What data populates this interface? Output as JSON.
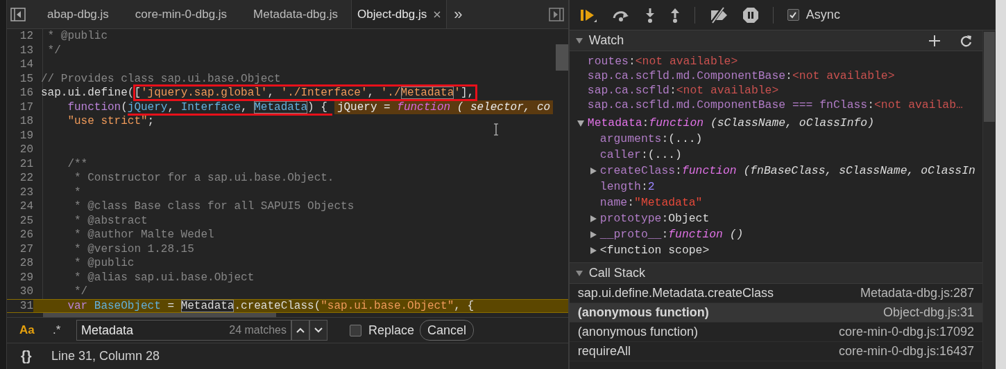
{
  "tabs": [
    {
      "label": "abap-dbg.js",
      "selected": false
    },
    {
      "label": "core-min-0-dbg.js",
      "selected": false
    },
    {
      "label": "Metadata-dbg.js",
      "selected": false
    },
    {
      "label": "Object-dbg.js",
      "selected": true
    }
  ],
  "more_tabs": "»",
  "code": {
    "lines": [
      {
        "number": "12",
        "paused": false,
        "segments": [
          {
            "text": " * @public",
            "kind": "comment"
          }
        ]
      },
      {
        "number": "13",
        "paused": false,
        "segments": [
          {
            "text": " */",
            "kind": "comment"
          }
        ]
      },
      {
        "number": "14",
        "paused": false
      },
      {
        "number": "15",
        "paused": false,
        "segments": [
          {
            "text": "// Provides class sap.ui.base.Object",
            "kind": "comment"
          }
        ]
      },
      {
        "number": "16",
        "paused": false,
        "segments": [
          {
            "text": "sap.ui.define([",
            "kind": "plain"
          },
          {
            "text": "'jquery.sap.global'",
            "kind": "string"
          },
          {
            "text": ", ",
            "kind": "plain"
          },
          {
            "text": "'./Interface'",
            "kind": "string"
          },
          {
            "text": ", ",
            "kind": "plain"
          },
          {
            "text": "'./",
            "kind": "string"
          },
          {
            "text": "Metadata",
            "kind": "string-match"
          },
          {
            "text": "'",
            "kind": "string"
          },
          {
            "text": "],",
            "kind": "plain"
          }
        ]
      },
      {
        "number": "17",
        "paused": false,
        "segments": [
          {
            "text": "    function",
            "kind": "keyword"
          },
          {
            "text": "(",
            "kind": "plain"
          },
          {
            "text": "jQuery",
            "kind": "param"
          },
          {
            "text": ", ",
            "kind": "plain"
          },
          {
            "text": "Interface",
            "kind": "param"
          },
          {
            "text": ", ",
            "kind": "plain"
          },
          {
            "text": "Metadata",
            "kind": "param-match"
          },
          {
            "text": ") {",
            "kind": "plain"
          }
        ],
        "inline_value": [
          {
            "text": "jQuery = ",
            "kind": "name"
          },
          {
            "text": "function",
            "kind": "keyword"
          },
          {
            "text": " ( selector, co",
            "kind": "args"
          }
        ]
      },
      {
        "number": "18",
        "paused": false,
        "segments": [
          {
            "text": "    \"use strict\"",
            "kind": "string"
          },
          {
            "text": ";",
            "kind": "plain"
          }
        ]
      },
      {
        "number": "19",
        "paused": false
      },
      {
        "number": "20",
        "paused": false
      },
      {
        "number": "21",
        "paused": false,
        "segments": [
          {
            "text": "    /**",
            "kind": "comment"
          }
        ]
      },
      {
        "number": "22",
        "paused": false,
        "segments": [
          {
            "text": "     * Constructor for a sap.ui.base.Object.",
            "kind": "comment"
          }
        ]
      },
      {
        "number": "23",
        "paused": false,
        "segments": [
          {
            "text": "     *",
            "kind": "comment"
          }
        ]
      },
      {
        "number": "24",
        "paused": false,
        "segments": [
          {
            "text": "     * @class Base class for all SAPUI5 Objects",
            "kind": "comment"
          }
        ]
      },
      {
        "number": "25",
        "paused": false,
        "segments": [
          {
            "text": "     * @abstract",
            "kind": "comment"
          }
        ]
      },
      {
        "number": "26",
        "paused": false,
        "segments": [
          {
            "text": "     * @author Malte Wedel",
            "kind": "comment"
          }
        ]
      },
      {
        "number": "27",
        "paused": false,
        "segments": [
          {
            "text": "     * @version 1.28.15",
            "kind": "comment"
          }
        ]
      },
      {
        "number": "28",
        "paused": false,
        "segments": [
          {
            "text": "     * @public",
            "kind": "comment"
          }
        ]
      },
      {
        "number": "29",
        "paused": false,
        "segments": [
          {
            "text": "     * @alias sap.ui.base.Object",
            "kind": "comment"
          }
        ]
      },
      {
        "number": "30",
        "paused": false,
        "segments": [
          {
            "text": "     */",
            "kind": "comment"
          }
        ]
      },
      {
        "number": "31",
        "paused": true,
        "segments": [
          {
            "text": "    var ",
            "kind": "keyword"
          },
          {
            "text": "BaseObject",
            "kind": "param"
          },
          {
            "text": " = ",
            "kind": "plain"
          },
          {
            "text": "Metadata",
            "kind": "plain-match"
          },
          {
            "text": ".createClass(",
            "kind": "plain"
          },
          {
            "text": "\"sap.ui.base.Object\"",
            "kind": "string"
          },
          {
            "text": ", {",
            "kind": "plain"
          }
        ]
      }
    ]
  },
  "search": {
    "case_toggle": "Aa",
    "case_sensitive": true,
    "regex_toggle": ".*",
    "value": "Metadata",
    "matches": "24 matches",
    "replace": {
      "label": "Replace",
      "checked": false
    },
    "cancel": "Cancel"
  },
  "status_bar": {
    "pretty_print": "{}",
    "position": "Line 31, Column 28"
  },
  "debugger": {
    "async": {
      "label": "Async",
      "checked": true
    }
  },
  "watch": {
    "title": "Watch",
    "expanded": true,
    "expressions": [
      {
        "name": "routes:",
        "value": "<not available>"
      },
      {
        "name": "sap.ca.scfld.md.ComponentBase:",
        "value": "<not available>"
      },
      {
        "name": "sap.ca.scfld:",
        "value": "<not available>"
      },
      {
        "name": "sap.ca.scfld.md.ComponentBase === fnClass:",
        "value": "<not availab…"
      }
    ],
    "tree": {
      "name": "Metadata:",
      "expanded": true,
      "value": [
        {
          "text": "function",
          "kind": "keyword"
        },
        {
          "text": " (sClassName, oClassInfo)",
          "kind": "args"
        }
      ],
      "children": [
        {
          "kind": "leaf",
          "name": "arguments:",
          "value": [
            {
              "text": "(...)",
              "kind": "plain"
            }
          ]
        },
        {
          "kind": "leaf",
          "name": "caller:",
          "value": [
            {
              "text": "(...)",
              "kind": "plain"
            }
          ]
        },
        {
          "kind": "group",
          "expanded": false,
          "name": "createClass:",
          "value": [
            {
              "text": "function",
              "kind": "keyword"
            },
            {
              "text": " (fnBaseClass, sClassName, oClassIn",
              "kind": "args"
            }
          ]
        },
        {
          "kind": "leaf",
          "name": "length:",
          "value": [
            {
              "text": "2",
              "kind": "number"
            }
          ]
        },
        {
          "kind": "leaf",
          "name": "name:",
          "value": [
            {
              "text": "\"Metadata\"",
              "kind": "string"
            }
          ]
        },
        {
          "kind": "group",
          "expanded": false,
          "name": "prototype:",
          "value": [
            {
              "text": "Object",
              "kind": "plain"
            }
          ]
        },
        {
          "kind": "group",
          "expanded": false,
          "name": "__proto__:",
          "value": [
            {
              "text": "function",
              "kind": "keyword"
            },
            {
              "text": " ()",
              "kind": "args"
            }
          ]
        },
        {
          "kind": "scope",
          "expanded": false,
          "name": "<function scope>"
        }
      ]
    }
  },
  "call_stack": {
    "title": "Call Stack",
    "expanded": true,
    "frames": [
      {
        "function": "sap.ui.define.Metadata.createClass",
        "location": "Metadata-dbg.js:287",
        "selected": false
      },
      {
        "function": "(anonymous function)",
        "location": "Object-dbg.js:31",
        "selected": true
      },
      {
        "function": "(anonymous function)",
        "location": "core-min-0-dbg.js:17092",
        "selected": false
      },
      {
        "function": "requireAll",
        "location": "core-min-0-dbg.js:16437",
        "selected": false
      }
    ]
  }
}
